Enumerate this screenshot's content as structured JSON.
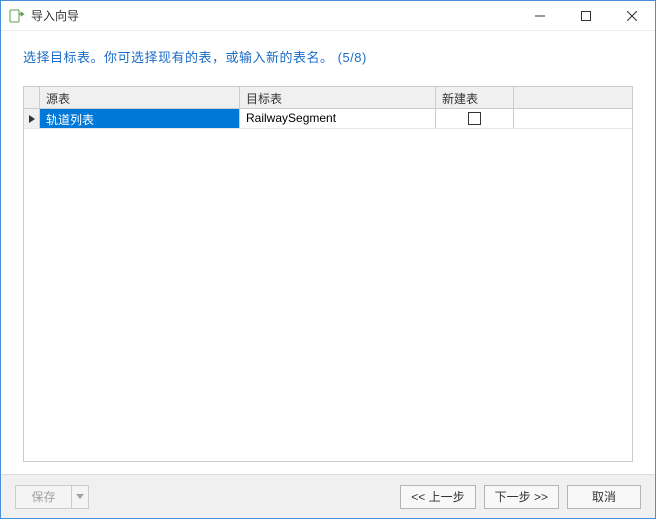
{
  "window": {
    "title": "导入向导"
  },
  "instruction": "选择目标表。你可选择现有的表，或输入新的表名。 (5/8)",
  "grid": {
    "headers": {
      "source": "源表",
      "target": "目标表",
      "new": "新建表"
    },
    "rows": [
      {
        "source": "轨道列表",
        "target": "RailwaySegment",
        "new_checked": false
      }
    ]
  },
  "buttons": {
    "save": "保存",
    "prev": "<< 上一步",
    "next": "下一步 >>",
    "cancel": "取消"
  }
}
